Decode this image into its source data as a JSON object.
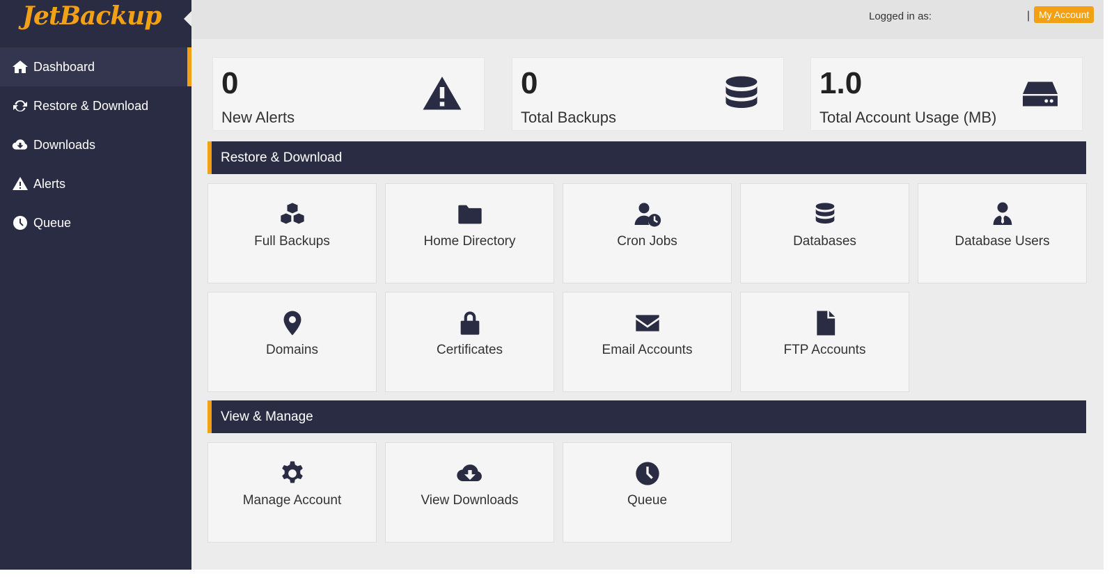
{
  "app": {
    "logo": "JetBackup"
  },
  "sidebar": {
    "items": [
      {
        "label": "Dashboard",
        "icon": "home-icon",
        "active": true
      },
      {
        "label": "Restore & Download",
        "icon": "sync-icon"
      },
      {
        "label": "Downloads",
        "icon": "cloud-download-icon"
      },
      {
        "label": "Alerts",
        "icon": "warning-icon"
      },
      {
        "label": "Queue",
        "icon": "clock-icon"
      }
    ]
  },
  "topbar": {
    "logged_in": "Logged in as:",
    "separator": "|",
    "my_account": "My Account"
  },
  "stats": [
    {
      "value": "0",
      "label": "New Alerts",
      "icon": "warning-icon"
    },
    {
      "value": "0",
      "label": "Total Backups",
      "icon": "database-icon"
    },
    {
      "value": "1.0",
      "label": "Total Account Usage (MB)",
      "icon": "hard-drive-icon"
    }
  ],
  "restore_section": {
    "title": "Restore & Download",
    "tiles": [
      {
        "label": "Full Backups",
        "icon": "cubes-icon"
      },
      {
        "label": "Home Directory",
        "icon": "folder-icon"
      },
      {
        "label": "Cron Jobs",
        "icon": "user-clock-icon"
      },
      {
        "label": "Databases",
        "icon": "database-icon"
      },
      {
        "label": "Database Users",
        "icon": "user-tie-icon"
      },
      {
        "label": "Domains",
        "icon": "map-marker-icon"
      },
      {
        "label": "Certificates",
        "icon": "lock-icon"
      },
      {
        "label": "Email Accounts",
        "icon": "envelope-icon"
      },
      {
        "label": "FTP Accounts",
        "icon": "file-icon"
      }
    ]
  },
  "manage_section": {
    "title": "View & Manage",
    "tiles": [
      {
        "label": "Manage Account",
        "icon": "gear-icon"
      },
      {
        "label": "View Downloads",
        "icon": "cloud-download-icon"
      },
      {
        "label": "Queue",
        "icon": "clock-icon"
      }
    ]
  },
  "colors": {
    "sidebar": "#2a2c44",
    "accent": "#f2a014",
    "content_bg": "#ececec",
    "tile_bg": "#f5f5f5"
  }
}
